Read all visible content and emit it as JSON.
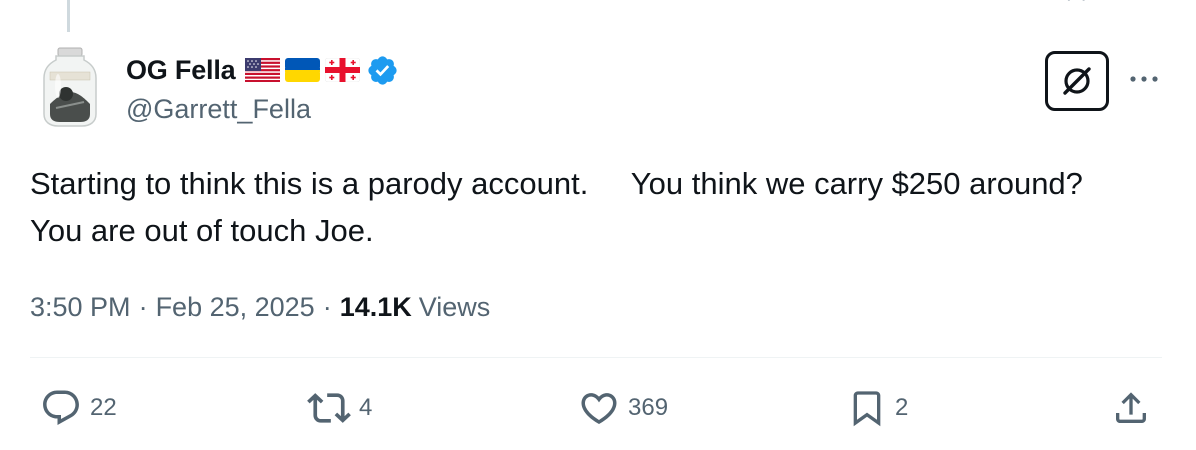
{
  "author": {
    "display_name": "OG Fella",
    "handle": "@Garrett_Fella",
    "flags": [
      "us-flag",
      "ukraine-flag",
      "georgia-flag"
    ],
    "verified": true
  },
  "tweet": {
    "text": "Starting to think this is a parody account.     You think we carry $250 around? You are out of touch Joe.",
    "time": "3:50 PM",
    "separator": "·",
    "date": "Feb 25, 2025",
    "views_count": "14.1K",
    "views_label": "Views"
  },
  "actions": {
    "reply_count": "22",
    "retweet_count": "4",
    "like_count": "369",
    "bookmark_count": "2"
  },
  "icons": {
    "grok": "grok-icon",
    "more": "more-icon",
    "reply": "reply-icon",
    "retweet": "retweet-icon",
    "like": "heart-icon",
    "bookmark": "bookmark-icon",
    "share": "share-icon"
  },
  "colors": {
    "text": "#0f1419",
    "secondary": "#536471",
    "verified": "#1d9bf0",
    "divider": "#eff3f4"
  }
}
